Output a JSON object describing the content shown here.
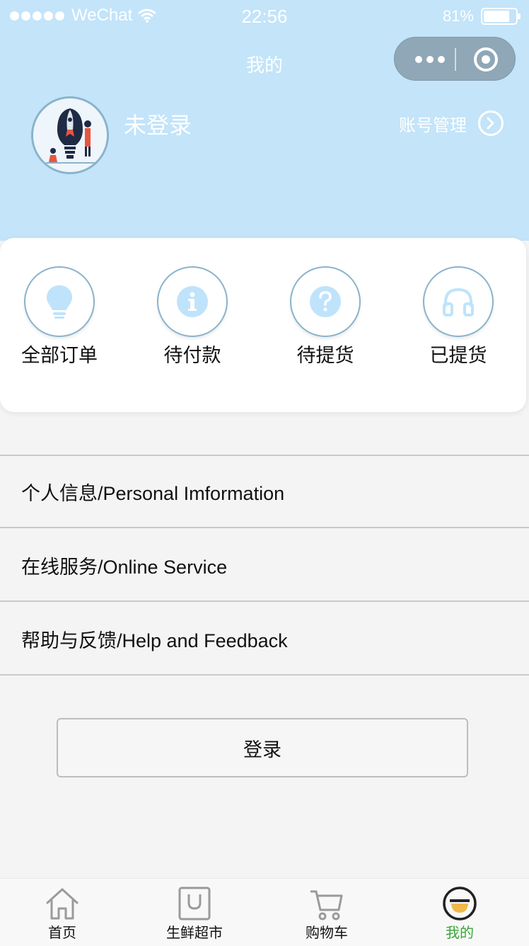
{
  "status_bar": {
    "carrier": "WeChat",
    "time": "22:56",
    "battery": "81%",
    "battery_level": 0.81
  },
  "header": {
    "title": "我的",
    "username": "未登录",
    "account_management": "账号管理"
  },
  "orders": [
    {
      "label": "全部订单",
      "icon": "bulb-icon"
    },
    {
      "label": "待付款",
      "icon": "info-icon"
    },
    {
      "label": "待提货",
      "icon": "question-icon"
    },
    {
      "label": "已提货",
      "icon": "headphones-icon"
    }
  ],
  "menu": [
    {
      "label": "个人信息/Personal Imformation"
    },
    {
      "label": "在线服务/Online Service"
    },
    {
      "label": "帮助与反馈/Help and Feedback"
    }
  ],
  "login_button": "登录",
  "tabbar": [
    {
      "label": "首页",
      "icon": "home-icon",
      "active": false
    },
    {
      "label": "生鲜超市",
      "icon": "bag-icon",
      "active": false
    },
    {
      "label": "购物车",
      "icon": "cart-icon",
      "active": false
    },
    {
      "label": "我的",
      "icon": "profile-icon",
      "active": true
    }
  ],
  "colors": {
    "header_bg": "#c3e4f9",
    "icon_blue": "#bfe3fb",
    "active_tab": "#3aa53a"
  }
}
